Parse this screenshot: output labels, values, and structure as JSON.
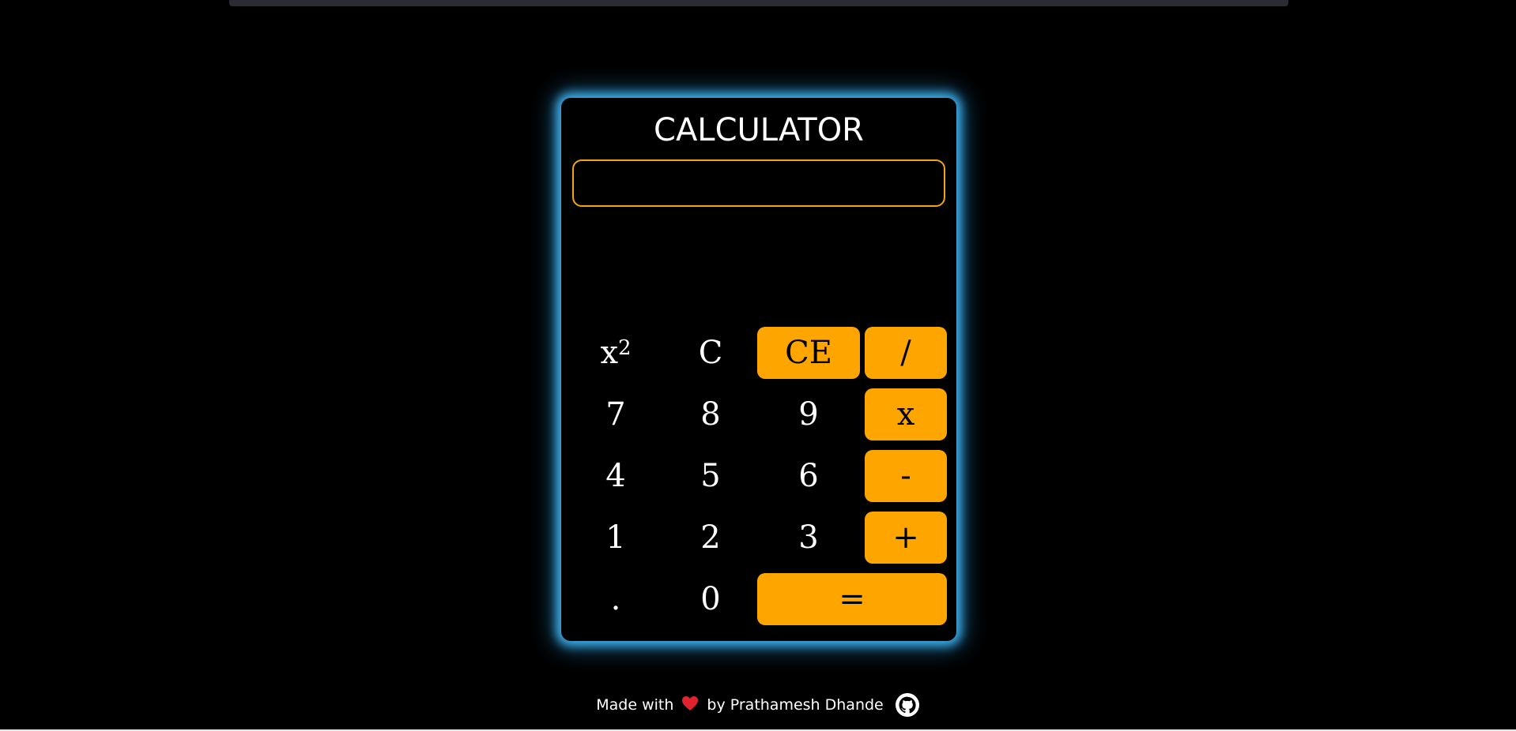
{
  "calculator": {
    "title": "CALCULATOR",
    "display_value": "",
    "keys": {
      "square": {
        "base": "x",
        "exponent": "2"
      },
      "clear": "C",
      "clear_entry": "CE",
      "divide": "/",
      "seven": "7",
      "eight": "8",
      "nine": "9",
      "multiply": "x",
      "four": "4",
      "five": "5",
      "six": "6",
      "subtract": "-",
      "one": "1",
      "two": "2",
      "three": "3",
      "add": "+",
      "decimal": ".",
      "zero": "0",
      "equals": "="
    }
  },
  "footer": {
    "made_with": "Made with",
    "by_text": "by Prathamesh Dhande",
    "heart_icon": "heart-icon",
    "github_icon": "github-icon"
  },
  "colors": {
    "accent": "#ffa500",
    "glow": "#40b4f0",
    "background": "#000000"
  }
}
